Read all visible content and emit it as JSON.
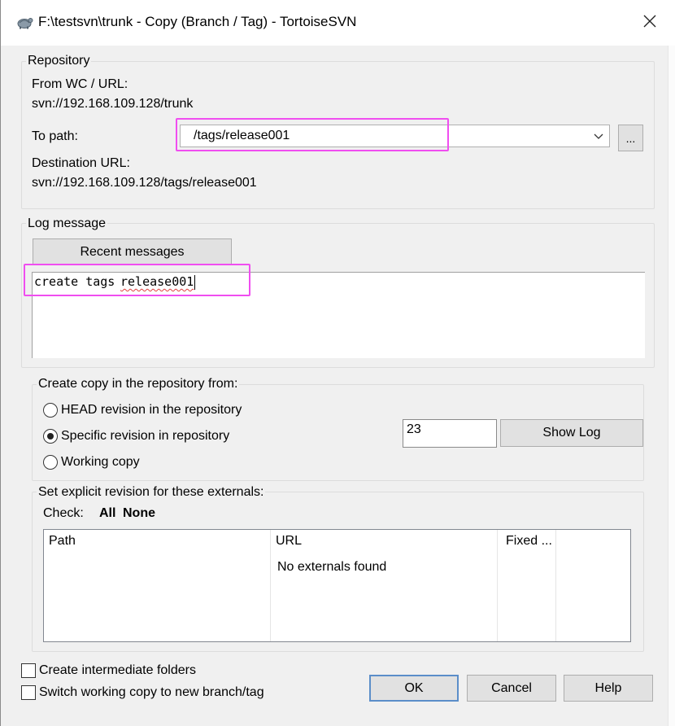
{
  "window": {
    "title": "F:\\testsvn\\trunk - Copy (Branch / Tag) - TortoiseSVN",
    "app_icon": "tortoisesvn-icon",
    "close_icon": "close-icon"
  },
  "repository": {
    "legend": "Repository",
    "from_label": "From WC / URL:",
    "from_value": "svn://192.168.109.128/trunk",
    "to_path_label": "To path:",
    "to_path_value": "/tags/release001",
    "browse_label": "...",
    "dest_label": "Destination URL:",
    "dest_value": "svn://192.168.109.128/tags/release001"
  },
  "log": {
    "legend": "Log message",
    "recent_button": "Recent messages",
    "message_prefix": "create tags ",
    "message_word": "release001"
  },
  "copy_from": {
    "legend": "Create copy in the repository from:",
    "options": [
      {
        "label": "HEAD revision in the repository",
        "selected": false
      },
      {
        "label": "Specific revision in repository",
        "selected": true
      },
      {
        "label": "Working copy",
        "selected": false
      }
    ],
    "revision_value": "23",
    "show_log_button": "Show Log"
  },
  "externals": {
    "legend": "Set explicit revision for these externals:",
    "check_label": "Check:",
    "all_link": "All",
    "none_link": "None",
    "columns": [
      "Path",
      "URL",
      "Fixed ..."
    ],
    "empty_text": "No externals found"
  },
  "options": {
    "create_intermediate": "Create intermediate folders",
    "switch_wc": "Switch working copy to new branch/tag"
  },
  "buttons": {
    "ok": "OK",
    "cancel": "Cancel",
    "help": "Help"
  },
  "highlight_color": "#f04ef0"
}
